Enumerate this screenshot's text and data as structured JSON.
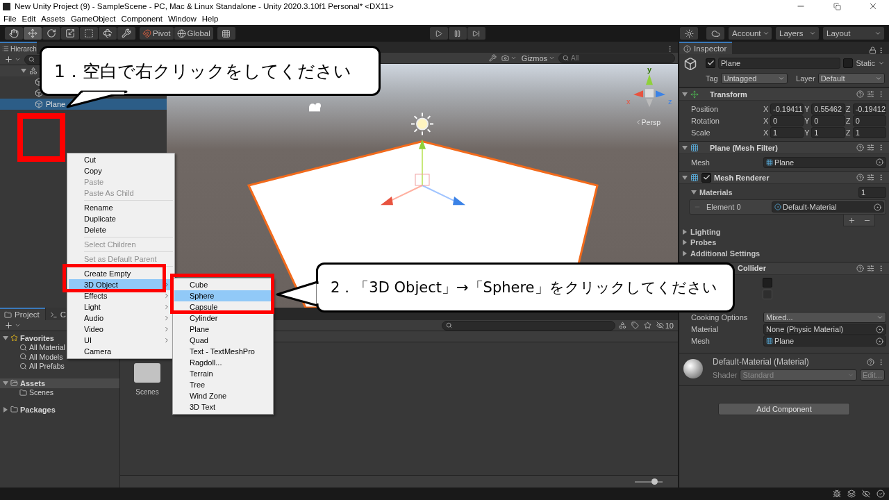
{
  "window": {
    "title": "New Unity Project (9) - SampleScene - PC, Mac & Linux Standalone - Unity 2020.3.10f1 Personal* <DX11>"
  },
  "menu_bar": [
    "File",
    "Edit",
    "Assets",
    "GameObject",
    "Component",
    "Window",
    "Help"
  ],
  "toolbar": {
    "tools": [
      {
        "kind": "hand",
        "selected": false
      },
      {
        "kind": "move",
        "selected": true
      },
      {
        "kind": "rotate",
        "selected": false
      },
      {
        "kind": "scale",
        "selected": false
      },
      {
        "kind": "rect",
        "selected": false
      },
      {
        "kind": "transform",
        "selected": false
      },
      {
        "kind": "custom",
        "selected": false
      }
    ],
    "pivot": "Pivot",
    "space": "Global",
    "account": "Account",
    "layers": "Layers",
    "layout": "Layout"
  },
  "hierarchy": {
    "tab": "Hierarch",
    "rows": [
      {
        "kind": "scene",
        "selected": false
      },
      {
        "kind": "object",
        "selected": false
      },
      {
        "kind": "object",
        "selected": false
      },
      {
        "kind": "object",
        "label": "Plane",
        "selected": true
      }
    ]
  },
  "scene_view": {
    "gizmos": "Gizmos",
    "search": {
      "placeholder": "All"
    },
    "camera_mode": "Persp",
    "axis_labels": [
      "y",
      "x",
      "z"
    ]
  },
  "context_menu": [
    {
      "kind": "item",
      "label": "Cut",
      "disabled": false,
      "submenu": false,
      "selected": false
    },
    {
      "kind": "item",
      "label": "Copy",
      "disabled": false,
      "submenu": false,
      "selected": false
    },
    {
      "kind": "item",
      "label": "Paste",
      "disabled": true,
      "submenu": false,
      "selected": false
    },
    {
      "kind": "item",
      "label": "Paste As Child",
      "disabled": true,
      "submenu": false,
      "selected": false
    },
    {
      "kind": "separator"
    },
    {
      "kind": "item",
      "label": "Rename",
      "disabled": false,
      "submenu": false,
      "selected": false
    },
    {
      "kind": "item",
      "label": "Duplicate",
      "disabled": false,
      "submenu": false,
      "selected": false
    },
    {
      "kind": "item",
      "label": "Delete",
      "disabled": false,
      "submenu": false,
      "selected": false
    },
    {
      "kind": "separator"
    },
    {
      "kind": "item",
      "label": "Select Children",
      "disabled": true,
      "submenu": false,
      "selected": false
    },
    {
      "kind": "separator"
    },
    {
      "kind": "item",
      "label": "Set as Default Parent",
      "disabled": true,
      "submenu": false,
      "selected": false
    },
    {
      "kind": "separator"
    },
    {
      "kind": "item",
      "label": "Create Empty",
      "disabled": false,
      "submenu": false,
      "selected": false
    },
    {
      "kind": "item",
      "label": "3D Object",
      "disabled": false,
      "submenu": true,
      "selected": true
    },
    {
      "kind": "item",
      "label": "Effects",
      "disabled": false,
      "submenu": true,
      "selected": false
    },
    {
      "kind": "item",
      "label": "Light",
      "disabled": false,
      "submenu": true,
      "selected": false
    },
    {
      "kind": "item",
      "label": "Audio",
      "disabled": false,
      "submenu": true,
      "selected": false
    },
    {
      "kind": "item",
      "label": "Video",
      "disabled": false,
      "submenu": true,
      "selected": false
    },
    {
      "kind": "item",
      "label": "UI",
      "disabled": false,
      "submenu": true,
      "selected": false
    },
    {
      "kind": "item",
      "label": "Camera",
      "disabled": false,
      "submenu": false,
      "selected": false
    }
  ],
  "submenu": [
    {
      "label": "Cube",
      "selected": false
    },
    {
      "label": "Sphere",
      "selected": true
    },
    {
      "label": "Capsule",
      "selected": false
    },
    {
      "label": "Cylinder",
      "selected": false
    },
    {
      "label": "Plane",
      "selected": false
    },
    {
      "label": "Quad",
      "selected": false
    },
    {
      "label": "Text - TextMeshPro",
      "selected": false
    },
    {
      "label": "Ragdoll...",
      "selected": false
    },
    {
      "label": "Terrain",
      "selected": false
    },
    {
      "label": "Tree",
      "selected": false
    },
    {
      "label": "Wind Zone",
      "selected": false
    },
    {
      "label": "3D Text",
      "selected": false
    }
  ],
  "callouts": [
    {
      "text": "1．空白で右クリックをしてください"
    },
    {
      "text": "2．「3D Object」→「Sphere」をクリックしてください"
    }
  ],
  "project": {
    "tabs": [
      {
        "label": "Project",
        "kind": "project",
        "selected": true
      },
      {
        "label": "C",
        "kind": "console",
        "selected": false
      }
    ],
    "tree": [
      {
        "label": "Favorites",
        "kind": "favorites",
        "expanded": true,
        "selected": false,
        "children": [
          {
            "label": "All Material",
            "kind": "search",
            "selected": false
          },
          {
            "label": "All Models",
            "kind": "search",
            "selected": false
          },
          {
            "label": "All Prefabs",
            "kind": "search",
            "selected": false
          }
        ]
      },
      {
        "label": "Assets",
        "kind": "folder",
        "expanded": true,
        "selected": true,
        "children": [
          {
            "label": "Scenes",
            "kind": "folder",
            "selected": false
          }
        ]
      },
      {
        "label": "Packages",
        "kind": "folder",
        "expanded": false,
        "selected": false
      }
    ],
    "hidden_count": "10",
    "items": [
      {
        "label": "Scenes"
      }
    ],
    "icon_size": {
      "level": 0.7
    }
  },
  "inspector": {
    "tab": "Inspector",
    "object": {
      "name": "Plane",
      "active": true,
      "static": false,
      "static_label": "Static",
      "tag_label": "Tag",
      "tag": "Untagged",
      "layer_label": "Layer",
      "layer": "Default"
    },
    "components": [
      {
        "kind": "transform",
        "title": "Transform",
        "rows": [
          {
            "label": "Position",
            "fields": [
              {
                "axis": "X",
                "value": "-0.19411"
              },
              {
                "axis": "Y",
                "value": "0.55462"
              },
              {
                "axis": "Z",
                "value": "-0.19412"
              }
            ]
          },
          {
            "label": "Rotation",
            "fields": [
              {
                "axis": "X",
                "value": "0"
              },
              {
                "axis": "Y",
                "value": "0"
              },
              {
                "axis": "Z",
                "value": "0"
              }
            ]
          },
          {
            "label": "Scale",
            "fields": [
              {
                "axis": "X",
                "value": "1"
              },
              {
                "axis": "Y",
                "value": "1"
              },
              {
                "axis": "Z",
                "value": "1"
              }
            ]
          }
        ]
      },
      {
        "kind": "mesh_filter",
        "title": "Plane (Mesh Filter)",
        "fields": [
          {
            "label": "Mesh",
            "value": "Plane",
            "kind": "mesh"
          }
        ]
      },
      {
        "kind": "mesh_renderer",
        "title": "Mesh Renderer",
        "enabled": true,
        "materials_label": "Materials",
        "materials_count": "1",
        "elements": [
          {
            "label": "Element 0",
            "value": "Default-Material"
          }
        ],
        "foldouts": [
          "Lighting",
          "Probes",
          "Additional Settings"
        ]
      },
      {
        "kind": "collider",
        "title": "Collider",
        "checkboxes": [
          {
            "checked": false,
            "disabled": false
          },
          {
            "checked": false,
            "disabled": true
          }
        ],
        "fields": [
          {
            "label": "Cooking Options",
            "value": "Mixed...",
            "kind": "dropdown"
          },
          {
            "label": "Material",
            "value": "None (Physic Material)",
            "kind": "object"
          },
          {
            "label": "Mesh",
            "value": "Plane",
            "kind": "mesh"
          }
        ]
      }
    ],
    "material": {
      "title": "Default-Material (Material)",
      "shader_label": "Shader",
      "shader": "Standard",
      "edit": "Edit..."
    },
    "add_component": "Add Component"
  }
}
